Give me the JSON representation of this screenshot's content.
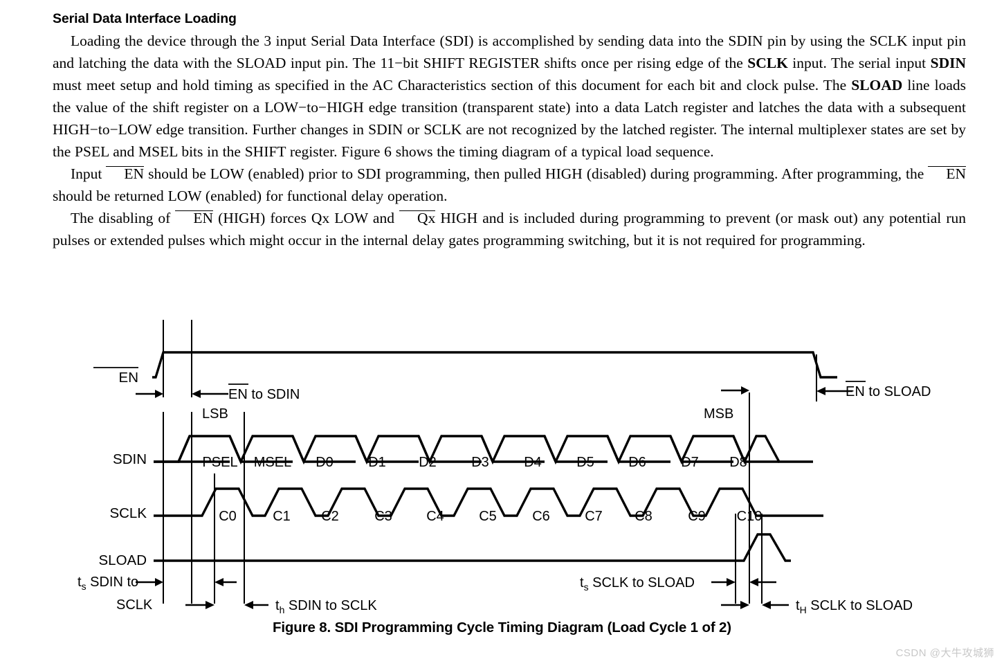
{
  "section": {
    "title": "Serial Data Interface Loading",
    "paragraphs": [
      {
        "id": "p1",
        "runs": [
          {
            "t": "Loading the device through the 3 input Serial Data Interface (SDI) is accomplished by sending data into the SDIN pin by using the SCLK input pin and latching the data with the SLOAD input pin. The 11−bit SHIFT REGISTER shifts once per rising edge of the ",
            "s": "n"
          },
          {
            "t": "SCLK",
            "s": "b"
          },
          {
            "t": " input. The serial input ",
            "s": "n"
          },
          {
            "t": "SDIN",
            "s": "b"
          },
          {
            "t": " must meet setup and hold timing as specified in the AC Characteristics section of this document for each bit and clock pulse. The ",
            "s": "n"
          },
          {
            "t": "SLOAD",
            "s": "b"
          },
          {
            "t": " line loads the value of the shift register on a LOW−to−HIGH edge transition (transparent state) into a data Latch register and latches the data with a subsequent HIGH−to−LOW edge transition. Further changes in SDIN or SCLK are not recognized by the latched register. The internal multiplexer states are set by the PSEL and MSEL bits in the SHIFT register. Figure 6 shows the timing diagram of a typical load sequence.",
            "s": "n"
          }
        ]
      },
      {
        "id": "p2",
        "runs": [
          {
            "t": "Input ",
            "s": "n"
          },
          {
            "t": "EN",
            "s": "o"
          },
          {
            "t": " should be LOW (enabled) prior to SDI programming, then pulled HIGH (disabled) during programming. After programming, the ",
            "s": "n"
          },
          {
            "t": "EN",
            "s": "o"
          },
          {
            "t": " should be returned LOW (enabled) for functional delay operation.",
            "s": "n"
          }
        ]
      },
      {
        "id": "p3",
        "runs": [
          {
            "t": "The disabling of ",
            "s": "n"
          },
          {
            "t": "EN",
            "s": "o"
          },
          {
            "t": " (HIGH) forces Qx LOW and ",
            "s": "n"
          },
          {
            "t": "Qx",
            "s": "o"
          },
          {
            "t": " HIGH and is included during programming to prevent (or mask out) any potential run pulses or extended pulses which might occur in the internal delay gates programming switching, but it is not required for programming.",
            "s": "n"
          }
        ]
      }
    ]
  },
  "figure": {
    "caption": "Figure 8. SDI Programming Cycle Timing Diagram (Load Cycle 1 of 2)",
    "watermark": "CSDN @大牛攻城狮",
    "signals": [
      {
        "name": "EN",
        "label": "EN",
        "overline": true
      },
      {
        "name": "SDIN",
        "label": "SDIN",
        "overline": false
      },
      {
        "name": "SCLK",
        "label": "SCLK",
        "overline": false
      },
      {
        "name": "SLOAD",
        "label": "SLOAD",
        "overline": false
      }
    ],
    "bit_markers": {
      "lsb": "LSB",
      "msb": "MSB"
    },
    "annotations": [
      {
        "id": "en_to_sdin",
        "pre": "EN",
        "overline": true,
        "post": " to SDIN"
      },
      {
        "id": "en_to_sload",
        "pre": "EN",
        "overline": true,
        "post": " to SLOAD"
      }
    ],
    "timing_params": [
      {
        "id": "ts_sdin_sclk",
        "sym": "t",
        "sub": "s",
        "text_line1": " SDIN to",
        "text_line2": "SCLK"
      },
      {
        "id": "th_sdin_sclk",
        "sym": "t",
        "sub": "h",
        "text": " SDIN to SCLK"
      },
      {
        "id": "ts_sclk_sload",
        "sym": "t",
        "sub": "s",
        "text": " SCLK to SLOAD"
      },
      {
        "id": "tH_sclk_sload",
        "sym": "t",
        "sub": "H",
        "text": " SCLK to SLOAD"
      }
    ]
  },
  "chart_data": {
    "type": "line",
    "title": "Figure 8. SDI Programming Cycle Timing Diagram (Load Cycle 1 of 2)",
    "xlabel": "",
    "ylabel": "",
    "grid": false,
    "legend_position": "none",
    "series": [
      {
        "name": "EN",
        "kind": "digital",
        "description": "Low before programming, rises HIGH (disabled) during the SDI load, falls LOW again after the SLOAD pulse."
      },
      {
        "name": "SDIN",
        "kind": "bus",
        "cells": [
          "PSEL",
          "MSEL",
          "D0",
          "D1",
          "D2",
          "D3",
          "D4",
          "D5",
          "D6",
          "D7",
          "D8"
        ],
        "bit_count": 11,
        "lsb_cell": "PSEL",
        "msb_cell": "D8"
      },
      {
        "name": "SCLK",
        "kind": "clock",
        "pulses": [
          "C0",
          "C1",
          "C2",
          "C3",
          "C4",
          "C5",
          "C6",
          "C7",
          "C8",
          "C9",
          "C10"
        ],
        "pulse_count": 11
      },
      {
        "name": "SLOAD",
        "kind": "digital",
        "description": "Stays LOW during the shift, single HIGH pulse after C10 to latch, then returns LOW."
      }
    ],
    "annotations": [
      "EN to SDIN",
      "EN to SLOAD",
      "LSB",
      "MSB",
      "ts SDIN to SCLK",
      "th SDIN to SCLK",
      "ts SCLK to SLOAD",
      "tH SCLK to SLOAD"
    ]
  }
}
